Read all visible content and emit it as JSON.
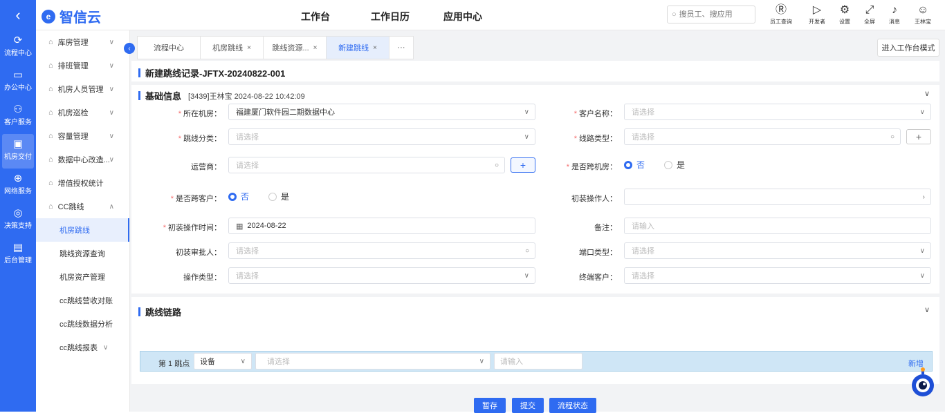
{
  "topbar": {
    "back_glyph": "‹",
    "logo_mark": "e",
    "logo_text": "智信云",
    "nav": [
      "工作台",
      "工作日历",
      "应用中心"
    ],
    "search_placeholder": "搜员工、搜应用",
    "icons": [
      {
        "icon": "employee-search-icon",
        "glyph": "Ⓡ",
        "label": "员工查询"
      },
      {
        "icon": "developer-icon",
        "glyph": "▷",
        "label": "开发者"
      },
      {
        "icon": "gear-icon",
        "glyph": "⚙",
        "label": "设置"
      },
      {
        "icon": "fullscreen-icon",
        "glyph": "⤢",
        "label": "全屏"
      },
      {
        "icon": "bell-icon",
        "glyph": "♪",
        "label": "消息"
      },
      {
        "icon": "avatar-icon",
        "glyph": "☺",
        "label": "王林宝"
      }
    ]
  },
  "rail": [
    {
      "icon": "flow-icon",
      "glyph": "⟳",
      "label": "流程中心"
    },
    {
      "icon": "office-icon",
      "glyph": "▭",
      "label": "办公中心"
    },
    {
      "icon": "customer-icon",
      "glyph": "⚇",
      "label": "客户服务"
    },
    {
      "icon": "datacenter-icon",
      "glyph": "▣",
      "label": "机房交付",
      "active": true
    },
    {
      "icon": "globe-icon",
      "glyph": "⊕",
      "label": "网络服务"
    },
    {
      "icon": "decision-icon",
      "glyph": "◎",
      "label": "决策支持"
    },
    {
      "icon": "admin-icon",
      "glyph": "▤",
      "label": "后台管理"
    }
  ],
  "menu": [
    {
      "label": "库房管理",
      "chev": "∨"
    },
    {
      "label": "排班管理",
      "chev": "∨"
    },
    {
      "label": "机房人员管理",
      "chev": "∨"
    },
    {
      "label": "机房巡检",
      "chev": "∨"
    },
    {
      "label": "容量管理",
      "chev": "∨"
    },
    {
      "label": "数据中心改造...",
      "chev": "∨"
    },
    {
      "label": "增值授权统计",
      "chev": ""
    },
    {
      "label": "CC跳线",
      "chev": "∧"
    }
  ],
  "submenu": [
    "机房跳线",
    "跳线资源查询",
    "机房资产管理",
    "cc跳线营收对账",
    "cc跳线数据分析",
    "cc跳线报表"
  ],
  "submenu_chev": "∨",
  "tabs": [
    {
      "label": "流程中心",
      "close": ""
    },
    {
      "label": "机房跳线",
      "close": "×"
    },
    {
      "label": "跳线资源...",
      "close": "×"
    },
    {
      "label": "新建跳线",
      "close": "×"
    },
    {
      "label": "···",
      "close": ""
    }
  ],
  "work_mode_button": "进入工作台模式",
  "record_title": "新建跳线记录-JFTX-20240822-001",
  "basic": {
    "title": "基础信息",
    "meta": "[3439]王林宝 2024-08-22 10:42:09",
    "fold": "∨"
  },
  "form": {
    "room_label": "所在机房：",
    "room_value": "福建厦门软件园二期数据中心",
    "customer_label": "客户名称：",
    "customer_ph": "请选择",
    "jumper_cat_label": "跳线分类：",
    "jumper_cat_ph": "请选择",
    "line_type_label": "线路类型：",
    "line_type_ph": "请选择",
    "carrier_label": "运营商：",
    "carrier_ph": "请选择",
    "cross_room_label": "是否跨机房：",
    "cross_customer_label": "是否跨客户：",
    "radio_no": "否",
    "radio_yes": "是",
    "installer_label": "初装操作人：",
    "install_time_label": "初装操作时间：",
    "install_time_value": "2024-08-22",
    "remark_label": "备注：",
    "remark_ph": "请输入",
    "approver_label": "初装审批人：",
    "approver_ph": "请选择",
    "port_type_label": "端口类型：",
    "port_type_ph": "请选择",
    "op_type_label": "操作类型：",
    "op_type_ph": "请选择",
    "end_customer_label": "终端客户：",
    "end_customer_ph": "请选择",
    "plus": "+"
  },
  "link": {
    "title": "跳线链路",
    "fold": "∨",
    "hop_label": "第 1 跳点",
    "device_value": "设备",
    "select_ph": "请选择",
    "input_ph": "请输入",
    "add": "新增"
  },
  "buttons": [
    "暂存",
    "提交",
    "流程状态"
  ],
  "colors": {
    "brand": "#2f6bf1",
    "required": "#f56c6c",
    "hop_row": "#cfe6f6"
  }
}
